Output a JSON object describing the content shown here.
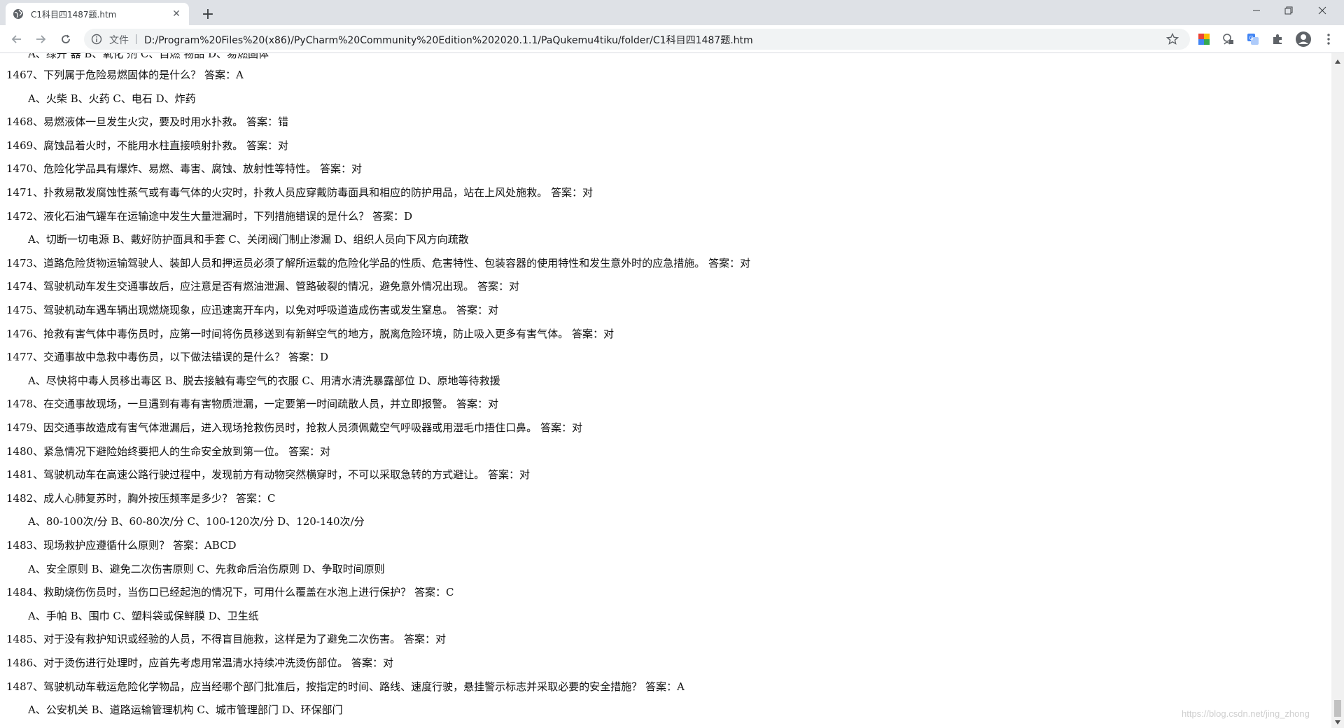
{
  "tab": {
    "title": "C1科目四1487题.htm"
  },
  "toolbar": {
    "scheme_label": "文件",
    "url": "D:/Program%20Files%20(x86)/PyCharm%20Community%20Edition%202020.1.1/PaQukemu4tiku/folder/C1科目四1487题.htm"
  },
  "content": {
    "cut_line": "A、绿开 器    B、氧化 剂    C、自燃 物品    D、易燃固体",
    "lines": [
      {
        "type": "q",
        "text": "1467、下列属于危险易燃固体的是什么？ 答案：A"
      },
      {
        "type": "o",
        "text": "A、火柴    B、火药    C、电石    D、炸药"
      },
      {
        "type": "q",
        "text": "1468、易燃液体一旦发生火灾，要及时用水扑救。 答案：错"
      },
      {
        "type": "q",
        "text": "1469、腐蚀品着火时，不能用水柱直接喷射扑救。 答案：对"
      },
      {
        "type": "q",
        "text": "1470、危险化学品具有爆炸、易燃、毒害、腐蚀、放射性等特性。 答案：对"
      },
      {
        "type": "q",
        "text": "1471、扑救易散发腐蚀性蒸气或有毒气体的火灾时，扑救人员应穿戴防毒面具和相应的防护用品，站在上风处施救。 答案：对"
      },
      {
        "type": "q",
        "text": "1472、液化石油气罐车在运输途中发生大量泄漏时，下列措施错误的是什么？ 答案：D"
      },
      {
        "type": "o",
        "text": "A、切断一切电源    B、戴好防护面具和手套    C、关闭阀门制止渗漏    D、组织人员向下风方向疏散"
      },
      {
        "type": "q",
        "text": "1473、道路危险货物运输驾驶人、装卸人员和押运员必须了解所运载的危险化学品的性质、危害特性、包装容器的使用特性和发生意外时的应急措施。 答案：对"
      },
      {
        "type": "q",
        "text": "1474、驾驶机动车发生交通事故后，应注意是否有燃油泄漏、管路破裂的情况，避免意外情况出现。 答案：对"
      },
      {
        "type": "q",
        "text": "1475、驾驶机动车遇车辆出现燃烧现象，应迅速离开车内，以免对呼吸道造成伤害或发生窒息。 答案：对"
      },
      {
        "type": "q",
        "text": "1476、抢救有害气体中毒伤员时，应第一时间将伤员移送到有新鲜空气的地方，脱离危险环境，防止吸入更多有害气体。 答案：对"
      },
      {
        "type": "q",
        "text": "1477、交通事故中急救中毒伤员，以下做法错误的是什么？ 答案：D"
      },
      {
        "type": "o",
        "text": "A、尽快将中毒人员移出毒区    B、脱去接触有毒空气的衣服    C、用清水清洗暴露部位    D、原地等待救援"
      },
      {
        "type": "q",
        "text": "1478、在交通事故现场，一旦遇到有毒有害物质泄漏，一定要第一时间疏散人员，并立即报警。 答案：对"
      },
      {
        "type": "q",
        "text": "1479、因交通事故造成有害气体泄漏后，进入现场抢救伤员时，抢救人员须佩戴空气呼吸器或用湿毛巾捂住口鼻。 答案：对"
      },
      {
        "type": "q",
        "text": "1480、紧急情况下避险始终要把人的生命安全放到第一位。 答案：对"
      },
      {
        "type": "q",
        "text": "1481、驾驶机动车在高速公路行驶过程中，发现前方有动物突然横穿时，不可以采取急转的方式避让。 答案：对"
      },
      {
        "type": "q",
        "text": "1482、成人心肺复苏时，胸外按压频率是多少？ 答案：C"
      },
      {
        "type": "o",
        "text": "A、80-100次/分    B、60-80次/分    C、100-120次/分    D、120-140次/分"
      },
      {
        "type": "q",
        "text": "1483、现场救护应遵循什么原则？ 答案：ABCD"
      },
      {
        "type": "o",
        "text": "A、安全原则    B、避免二次伤害原则    C、先救命后治伤原则    D、争取时间原则"
      },
      {
        "type": "q",
        "text": "1484、救助烧伤伤员时，当伤口已经起泡的情况下，可用什么覆盖在水泡上进行保护？ 答案：C"
      },
      {
        "type": "o",
        "text": "A、手帕    B、围巾    C、塑料袋或保鲜膜    D、卫生纸"
      },
      {
        "type": "q",
        "text": "1485、对于没有救护知识或经验的人员，不得盲目施救，这样是为了避免二次伤害。 答案：对"
      },
      {
        "type": "q",
        "text": "1486、对于烫伤进行处理时，应首先考虑用常温清水持续冲洗烫伤部位。 答案：对"
      },
      {
        "type": "q",
        "text": "1487、驾驶机动车载运危险化学物品，应当经哪个部门批准后，按指定的时间、路线、速度行驶，悬挂警示标志并采取必要的安全措施？ 答案：A"
      },
      {
        "type": "o",
        "text": "A、公安机关    B、道路运输管理机构    C、城市管理部门    D、环保部门"
      }
    ]
  },
  "watermark": "https://blog.csdn.net/jing_zhong"
}
